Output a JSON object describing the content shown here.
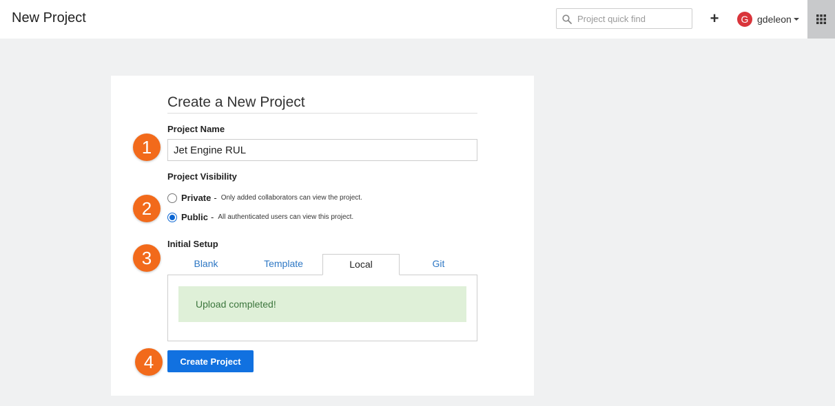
{
  "header": {
    "title": "New Project",
    "search_placeholder": "Project quick find",
    "plus_label": "+",
    "user": {
      "initial": "G",
      "name": "gdeleon"
    }
  },
  "form": {
    "heading": "Create a New Project",
    "project_name_label": "Project Name",
    "project_name_value": "Jet Engine RUL",
    "visibility_label": "Project Visibility",
    "visibility_options": [
      {
        "title": "Private",
        "dash": "-",
        "description": "Only added collaborators can view the project.",
        "selected": false
      },
      {
        "title": "Public",
        "dash": "-",
        "description": "All authenticated users can view this project.",
        "selected": true
      }
    ],
    "setup_label": "Initial Setup",
    "tabs": [
      "Blank",
      "Template",
      "Local",
      "Git"
    ],
    "active_tab": "Local",
    "upload_message": "Upload completed!",
    "create_button": "Create Project"
  },
  "badges": [
    "1",
    "2",
    "3",
    "4"
  ],
  "colors": {
    "badge": "#f26a1b",
    "primary_button": "#1171e0",
    "link": "#2d77c4",
    "success_bg": "#dff0d8",
    "success_text": "#3c763d",
    "avatar": "#d9353b"
  }
}
